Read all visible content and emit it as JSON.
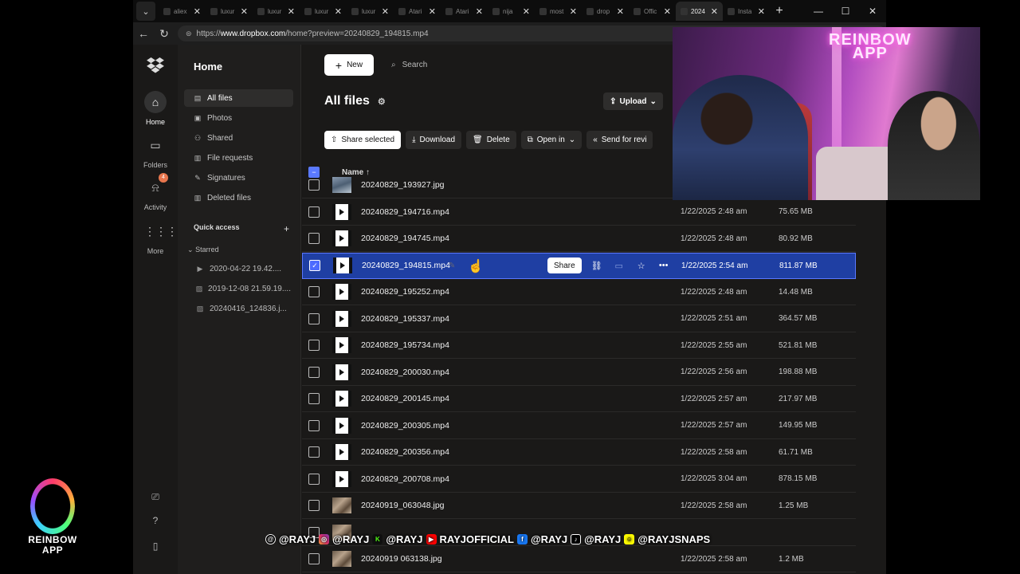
{
  "browser": {
    "tabs": [
      {
        "label": "aliex"
      },
      {
        "label": "luxur"
      },
      {
        "label": "luxur"
      },
      {
        "label": "luxur"
      },
      {
        "label": "luxur"
      },
      {
        "label": "Atari"
      },
      {
        "label": "Atari"
      },
      {
        "label": "nija"
      },
      {
        "label": "most"
      },
      {
        "label": "drop"
      },
      {
        "label": "Offic"
      },
      {
        "label": "2024",
        "active": true
      },
      {
        "label": "Insta"
      }
    ],
    "url_prefix": "https://",
    "url_host": "www.dropbox.com",
    "url_path": "/home?preview=20240829_194815.mp4"
  },
  "rail": {
    "home": "Home",
    "folders": "Folders",
    "activity": "Activity",
    "activity_badge": "4",
    "more": "More"
  },
  "sidenav": {
    "title": "Home",
    "items": [
      {
        "label": "All files",
        "icon": "all-files-icon"
      },
      {
        "label": "Photos",
        "icon": "photos-icon"
      },
      {
        "label": "Shared",
        "icon": "shared-icon"
      },
      {
        "label": "File requests",
        "icon": "file-requests-icon"
      },
      {
        "label": "Signatures",
        "icon": "signatures-icon"
      },
      {
        "label": "Deleted files",
        "icon": "deleted-files-icon"
      }
    ],
    "quick_access": "Quick access",
    "starred": "Starred",
    "starred_items": [
      {
        "label": "2020-04-22 19.42...."
      },
      {
        "label": "2019-12-08 21.59.19...."
      },
      {
        "label": "20240416_124836.j..."
      }
    ]
  },
  "main": {
    "new_label": "New",
    "search_placeholder": "Search",
    "title": "All files",
    "upload_label": "Upload",
    "actions": {
      "share_selected": "Share selected",
      "download": "Download",
      "delete": "Delete",
      "open_in": "Open in",
      "send_for_review": "Send for revi"
    },
    "column_name": "Name",
    "row_share": "Share",
    "files": [
      {
        "name": "20240829_193927.jpg",
        "modified": "",
        "size": "",
        "kind": "photo2"
      },
      {
        "name": "20240829_194716.mp4",
        "modified": "1/22/2025 2:48 am",
        "size": "75.65 MB",
        "kind": "video"
      },
      {
        "name": "20240829_194745.mp4",
        "modified": "1/22/2025 2:48 am",
        "size": "80.92 MB",
        "kind": "video"
      },
      {
        "name": "20240829_194815.mp4",
        "modified": "1/22/2025 2:54 am",
        "size": "811.87 MB",
        "kind": "video",
        "selected": true
      },
      {
        "name": "20240829_195252.mp4",
        "modified": "1/22/2025 2:48 am",
        "size": "14.48 MB",
        "kind": "video"
      },
      {
        "name": "20240829_195337.mp4",
        "modified": "1/22/2025 2:51 am",
        "size": "364.57 MB",
        "kind": "video"
      },
      {
        "name": "20240829_195734.mp4",
        "modified": "1/22/2025 2:55 am",
        "size": "521.81 MB",
        "kind": "video"
      },
      {
        "name": "20240829_200030.mp4",
        "modified": "1/22/2025 2:56 am",
        "size": "198.88 MB",
        "kind": "video"
      },
      {
        "name": "20240829_200145.mp4",
        "modified": "1/22/2025 2:57 am",
        "size": "217.97 MB",
        "kind": "video"
      },
      {
        "name": "20240829_200305.mp4",
        "modified": "1/22/2025 2:57 am",
        "size": "149.95 MB",
        "kind": "video"
      },
      {
        "name": "20240829_200356.mp4",
        "modified": "1/22/2025 2:58 am",
        "size": "61.71 MB",
        "kind": "video"
      },
      {
        "name": "20240829_200708.mp4",
        "modified": "1/22/2025 3:04 am",
        "size": "878.15 MB",
        "kind": "video"
      },
      {
        "name": "20240919_063048.jpg",
        "modified": "1/22/2025 2:58 am",
        "size": "1.25 MB",
        "kind": "photo"
      },
      {
        "name": "",
        "modified": "",
        "size": "",
        "kind": "photo"
      },
      {
        "name": "20240919 063138.jpg",
        "modified": "1/22/2025 2:58 am",
        "size": "1.2 MB",
        "kind": "photo"
      }
    ]
  },
  "overlay": {
    "cam_logo_line1": "REINBOW",
    "cam_logo_line2": "APP",
    "brand_line1": "REINBOW",
    "brand_line2": "APP",
    "ticker": [
      {
        "icon": "threads-icon",
        "cls": "threads",
        "glyph": "@",
        "handle": "@RAYJ"
      },
      {
        "icon": "instagram-icon",
        "cls": "insta",
        "glyph": "◎",
        "handle": "@RAYJ"
      },
      {
        "icon": "kick-icon",
        "cls": "kick",
        "glyph": "K",
        "handle": "@RAYJ"
      },
      {
        "icon": "youtube-icon",
        "cls": "yt",
        "glyph": "▶",
        "handle": "RAYJOFFICIAL"
      },
      {
        "icon": "facebook-icon",
        "cls": "fb",
        "glyph": "f",
        "handle": "@RAYJ"
      },
      {
        "icon": "tiktok-icon",
        "cls": "tt",
        "glyph": "♪",
        "handle": "@RAYJ"
      },
      {
        "icon": "snapchat-icon",
        "cls": "snap",
        "glyph": "☺",
        "handle": "@RAYJSNAPS"
      }
    ]
  },
  "colors": {
    "selected_row": "#1f3fa3",
    "checkbox_blue": "#4d6bff",
    "badge_orange": "#e8764d"
  }
}
